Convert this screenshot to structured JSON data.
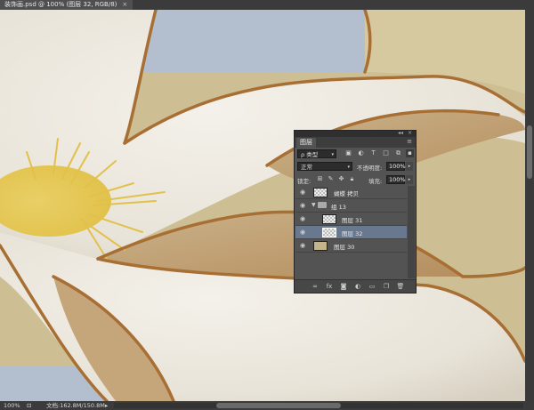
{
  "document_tab": {
    "title": "装饰画.psd @ 100% (图层 32, RGB/8)",
    "close": "×"
  },
  "status": {
    "zoom": "100%",
    "doc_info": "文档:162.8M/150.8M",
    "arrow": "▸"
  },
  "layers_panel": {
    "tab_label": "图层",
    "menu_glyph": "≡",
    "top_controls": {
      "collapse": "◂◂",
      "close": "×"
    },
    "filter": {
      "label": "ρ 类型",
      "arrow": "▾"
    },
    "filter_icons": [
      "image-filter-icon",
      "adjustment-filter-icon",
      "type-filter-icon",
      "shape-filter-icon",
      "smart-object-filter-icon",
      "filter-toggle-icon"
    ],
    "blend_mode": {
      "value": "正常",
      "arrow": "▾"
    },
    "opacity": {
      "label": "不透明度:",
      "value": "100%",
      "arrow": "▸"
    },
    "lock": {
      "label": "锁定:"
    },
    "fill": {
      "label": "填充:",
      "value": "100%",
      "arrow": "▸"
    },
    "layers": [
      {
        "name": "蝴蝶 拷贝",
        "selected": false
      },
      {
        "name": "组 13",
        "selected": false,
        "group": true
      },
      {
        "name": "图层 31",
        "selected": false
      },
      {
        "name": "图层 32",
        "selected": true
      },
      {
        "name": "图层 30",
        "selected": false
      }
    ],
    "bottom_icons": [
      "link-layers-icon",
      "fx-icon",
      "add-mask-icon",
      "adjustment-layer-icon",
      "new-group-icon",
      "new-layer-icon",
      "delete-layer-icon"
    ]
  },
  "colors": {
    "petal": "#ece8e0",
    "outline": "#a86f34",
    "sky": "#b3bfcf",
    "background": "#cdbf93",
    "stamen": "#e6c74a",
    "selected_layer": "#68788f"
  }
}
